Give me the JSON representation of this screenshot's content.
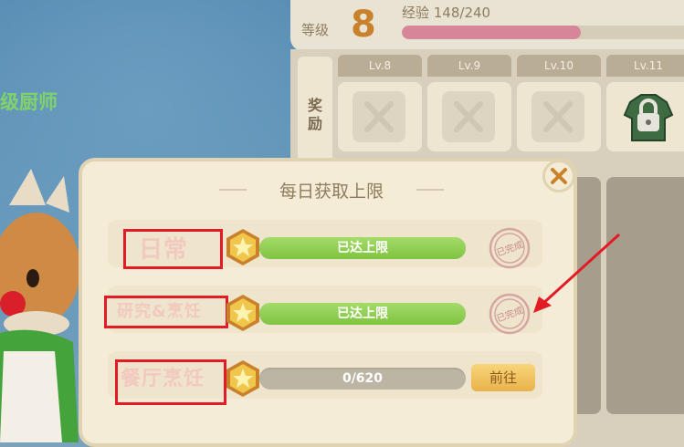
{
  "header": {
    "level_label": "等级",
    "level_value": "8",
    "exp_text": "经验 148/240",
    "exp_progress": 0.617
  },
  "rewards": {
    "label": "奖励",
    "levels": [
      {
        "label": "Lv.8",
        "state": "unavailable"
      },
      {
        "label": "Lv.9",
        "state": "unavailable"
      },
      {
        "label": "Lv.10",
        "state": "unavailable"
      },
      {
        "label": "Lv.11",
        "state": "locked"
      }
    ]
  },
  "character": {
    "title_fragment": "级厨师"
  },
  "modal": {
    "title": "每日获取上限",
    "rows": [
      {
        "label": "日常",
        "status_text": "已达上限",
        "progress": 1.0,
        "stamp": "已完成"
      },
      {
        "label": "研究&烹饪",
        "status_text": "已达上限",
        "progress": 1.0,
        "stamp": "已完成"
      },
      {
        "label": "餐厅烹饪",
        "status_text": "0/620",
        "progress": 0.0,
        "button": "前往"
      }
    ]
  },
  "colors": {
    "annotation": "#e21b25",
    "progress_fill": "#8fd050",
    "level_number": "#c9822b"
  }
}
